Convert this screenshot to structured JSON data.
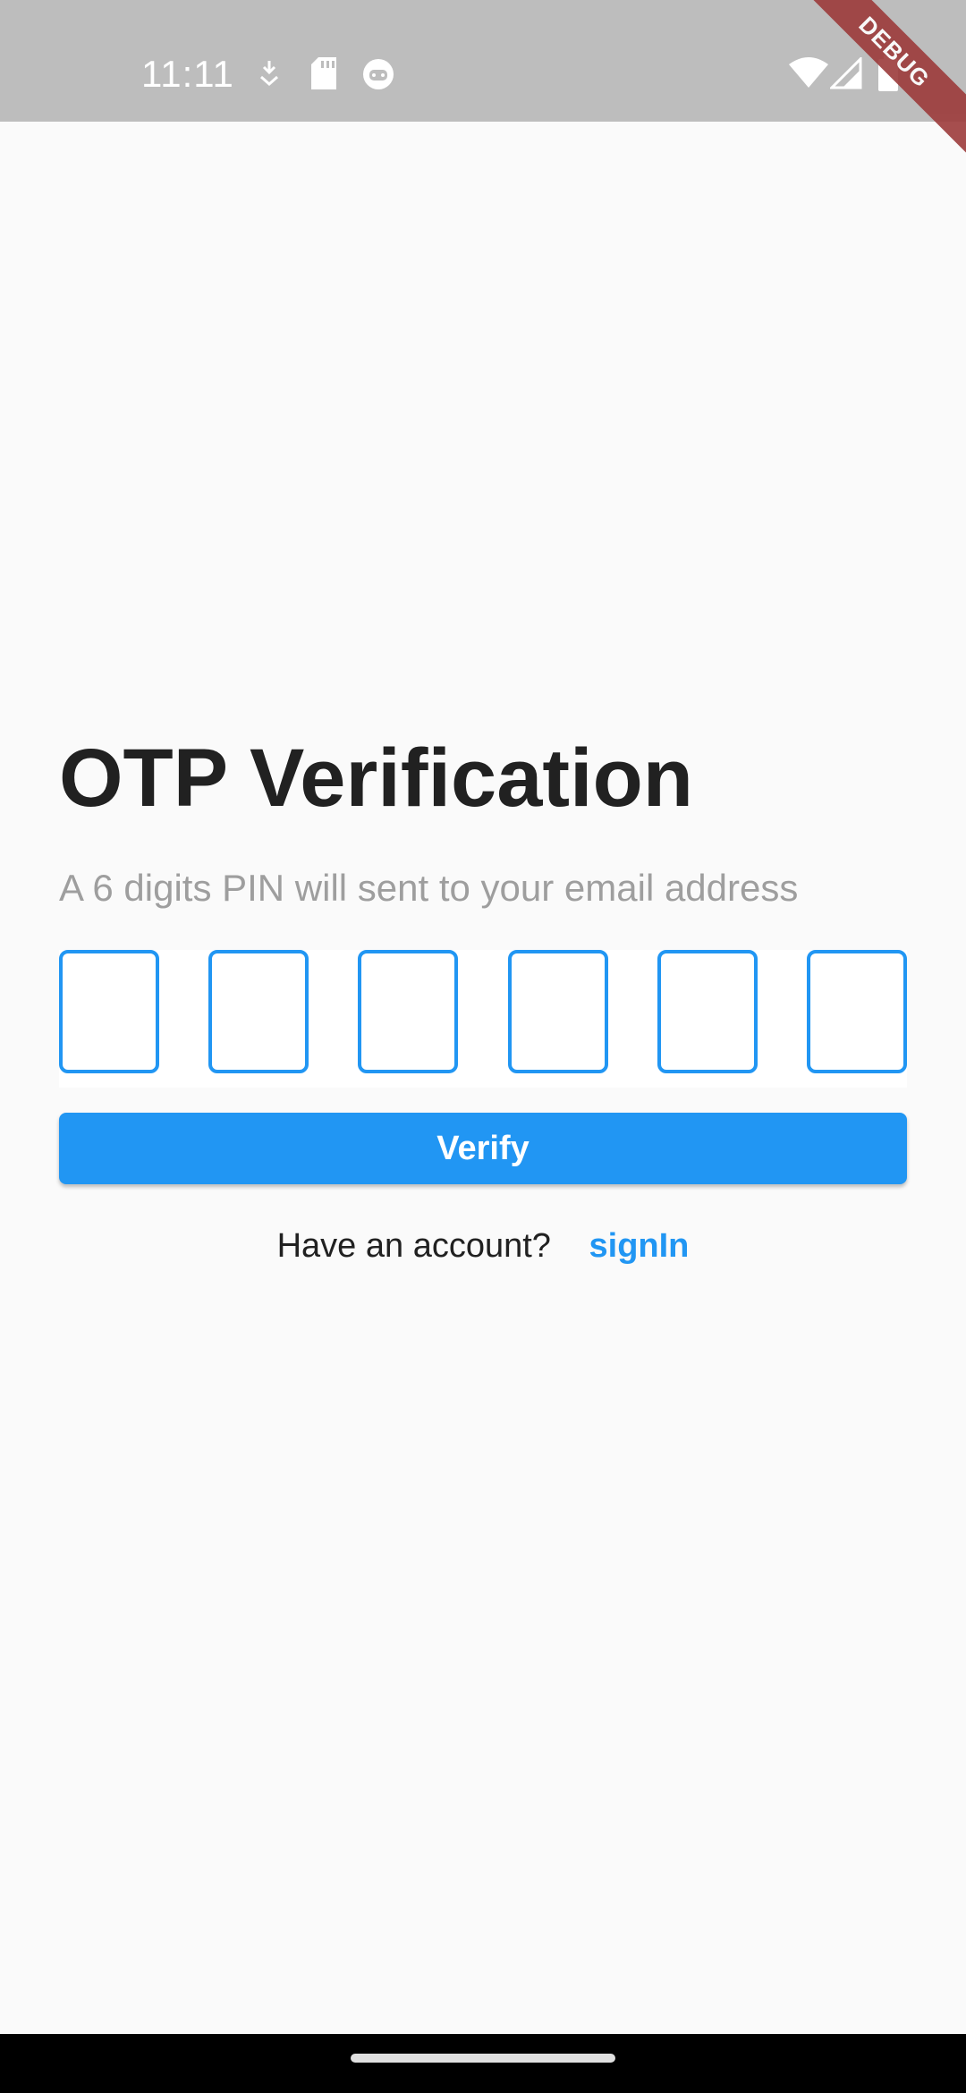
{
  "status_bar": {
    "time": "11:11",
    "icons_left": [
      "download-icon",
      "sd-card-icon",
      "face-icon"
    ],
    "icons_right": [
      "wifi-icon",
      "signal-icon",
      "battery-icon"
    ],
    "debug_label": "DEBUG"
  },
  "screen": {
    "title": "OTP Verification",
    "subtitle": "A 6 digits PIN will sent to your email address",
    "otp_boxes": [
      "",
      "",
      "",
      "",
      "",
      ""
    ],
    "verify_label": "Verify",
    "have_account": "Have an account?",
    "signin_label": "signIn"
  },
  "colors": {
    "accent": "#2196f3",
    "status_bar": "#bdbdbd",
    "background": "#fafafa",
    "debug_banner": "#9c3b3b"
  }
}
